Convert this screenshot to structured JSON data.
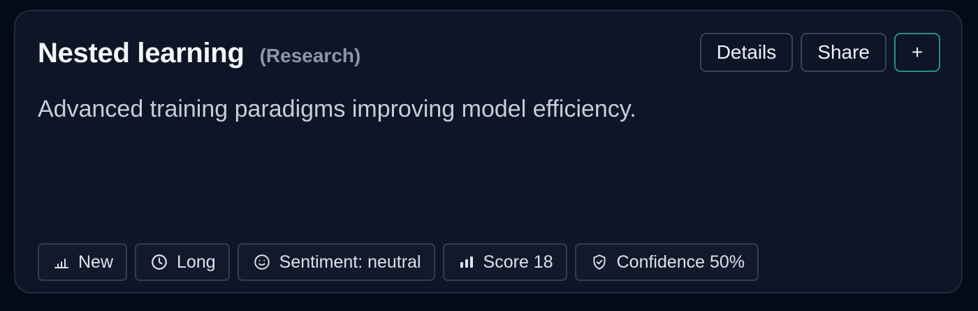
{
  "card": {
    "title": "Nested learning",
    "category": "(Research)",
    "description": "Advanced training paradigms improving model efficiency."
  },
  "actions": {
    "details_label": "Details",
    "share_label": "Share",
    "add_label": "+"
  },
  "chips": [
    {
      "icon": "bar-chart-icon",
      "label": "New"
    },
    {
      "icon": "clock-icon",
      "label": "Long"
    },
    {
      "icon": "smile-icon",
      "label": "Sentiment: neutral"
    },
    {
      "icon": "signal-bars-icon",
      "label": "Score 18"
    },
    {
      "icon": "shield-check-icon",
      "label": "Confidence 50%"
    }
  ],
  "colors": {
    "background": "#050a18",
    "card_background": "#0d1526",
    "accent_border": "#2a8f7b",
    "title_text": "#f3f5f8",
    "muted_text": "#8b97a8"
  }
}
